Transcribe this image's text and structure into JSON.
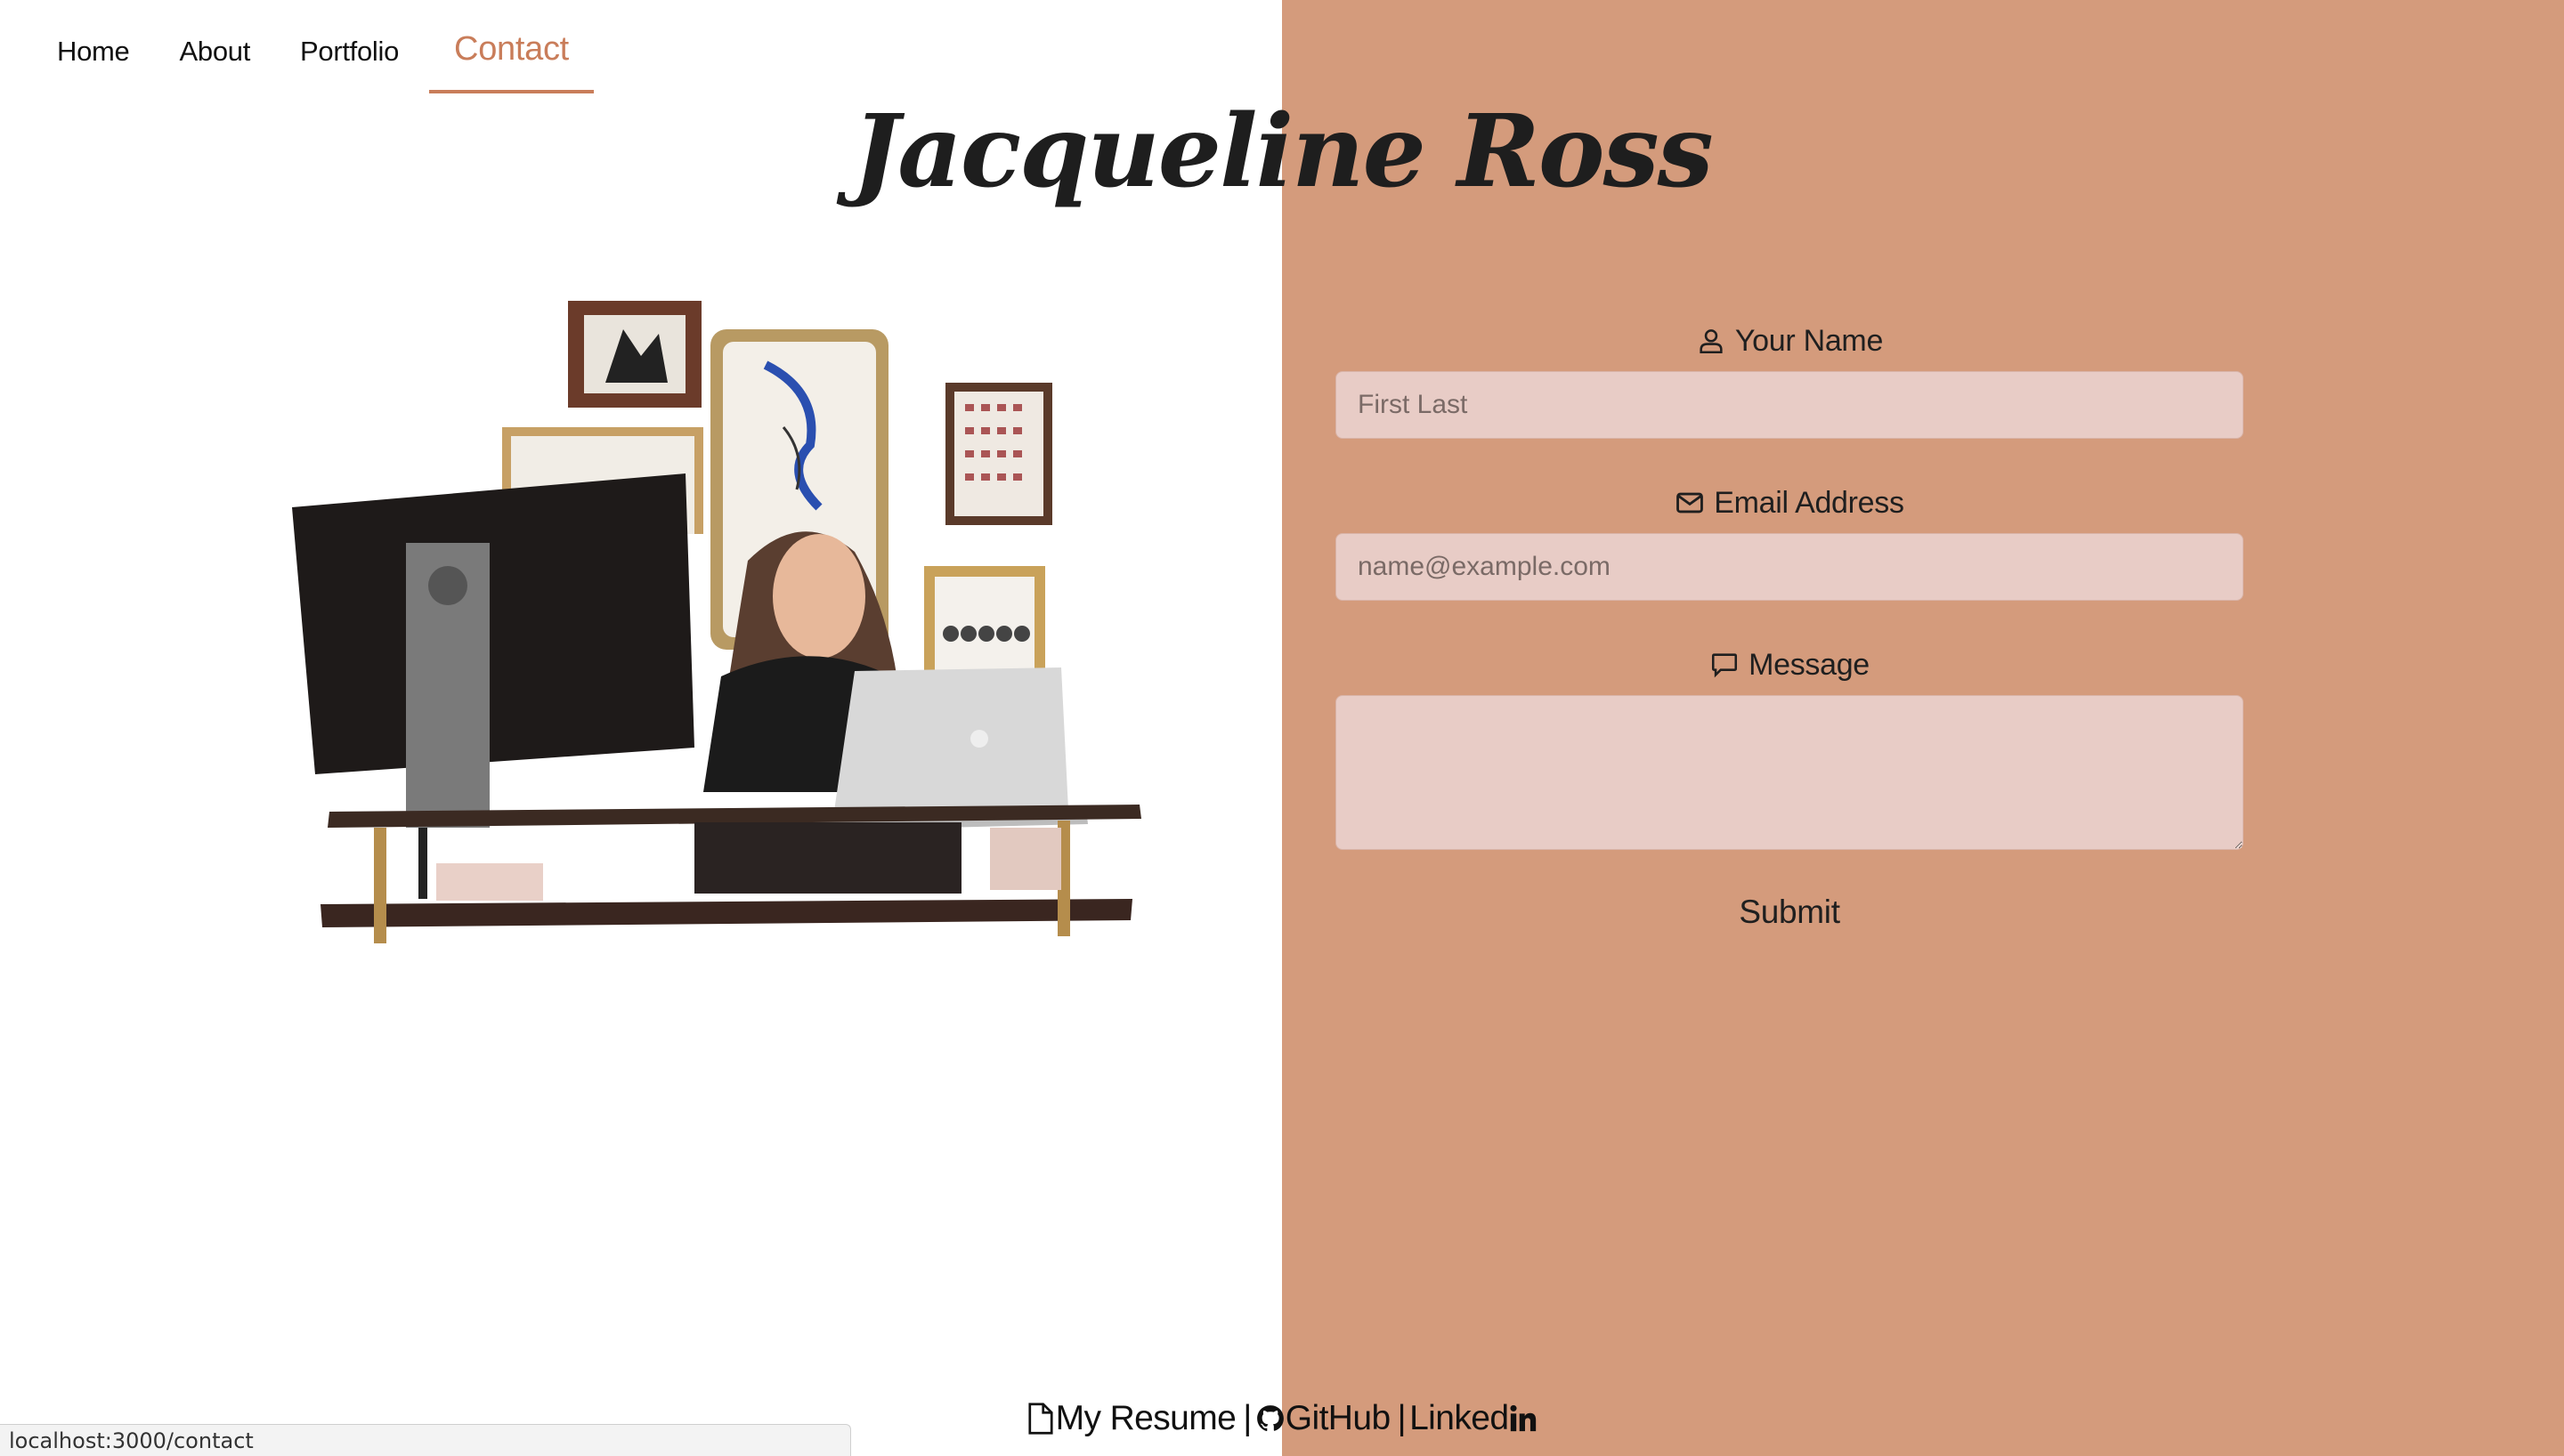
{
  "nav": {
    "items": [
      {
        "label": "Home"
      },
      {
        "label": "About"
      },
      {
        "label": "Portfolio"
      },
      {
        "label": "Contact"
      }
    ],
    "active": "Contact"
  },
  "header": {
    "title": "Jacqueline Ross"
  },
  "form": {
    "name_label": "Your Name",
    "name_placeholder": "First Last",
    "email_label": "Email Address",
    "email_placeholder": "name@example.com",
    "message_label": "Message",
    "submit_label": "Submit"
  },
  "footer": {
    "resume_label": "My Resume",
    "separator": "|",
    "github_label": "GitHub",
    "linkedin_label": "Linked"
  },
  "statusbar": {
    "url": "localhost:3000/contact"
  },
  "colors": {
    "accent": "#c97d5a",
    "right_panel": "#d49b7c",
    "input_bg": "#e8ccc6"
  },
  "icons": {
    "name": "user-icon",
    "email": "envelope-icon",
    "message": "chat-bubble-icon",
    "resume": "file-icon",
    "github": "github-icon",
    "linkedin": "linkedin-icon"
  }
}
